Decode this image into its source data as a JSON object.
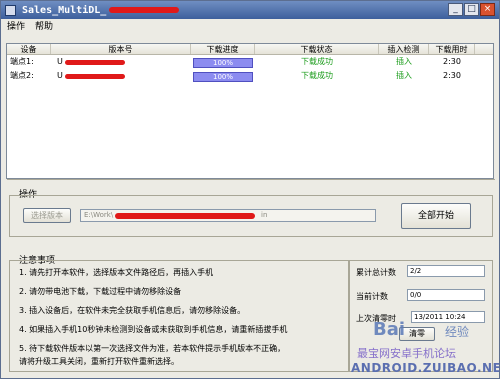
{
  "window": {
    "title": "Sales_MultiDL_",
    "controls": [
      "_",
      "□",
      "×"
    ]
  },
  "menu": [
    "操作",
    "帮助"
  ],
  "table": {
    "headers": [
      "设备",
      "版本号",
      "下载进度",
      "下载状态",
      "插入检测",
      "下载用时"
    ],
    "rows": [
      {
        "device": "端点1:",
        "version": "U",
        "progress": "100%",
        "progress_value": 100,
        "status": "下载成功",
        "detect": "插入",
        "time": "2:30"
      },
      {
        "device": "端点2:",
        "version": "U",
        "progress": "100%",
        "progress_value": 100,
        "status": "下载成功",
        "detect": "插入",
        "time": "2:30"
      }
    ]
  },
  "operate": {
    "title": "操作",
    "select_version_label": "选择版本",
    "path_prefix": "E:\\Work\\",
    "path_suffix": "in",
    "start_all_label": "全部开始"
  },
  "notes": {
    "title": "注意事项",
    "items": [
      "1.  请先打开本软件，选择版本文件路径后，再插入手机",
      "2.  请勿带电池下载，下载过程中请勿移除设备",
      "3.  插入设备后，在软件未完全获取手机信息后，请勿移除设备。",
      "4.  如果插入手机10秒钟未检测到设备或未获取到手机信息，请重新插拔手机",
      "5.  待下载软件版本以第一次选择文件为准，若本软件提示手机版本不正确，",
      "     请将升级工具关闭，重新打开软件重新选择。"
    ]
  },
  "stats": {
    "total_label": "累计总计数",
    "total_value": "2/2",
    "current_label": "当前计数",
    "current_value": "0/0",
    "last_clear_label": "上次清零时",
    "last_clear_value": "13/2011 10:24",
    "clear_button": "清零"
  },
  "watermarks": [
    "Bai",
    "经验",
    "最宝网安卓手机论坛",
    "ANDROID.ZUIBAO.NET"
  ],
  "colors": {
    "titlebar": "#3d5f9c",
    "progress": "#8c8cf0",
    "success": "#1b9c1b",
    "redaction": "#e01919"
  }
}
